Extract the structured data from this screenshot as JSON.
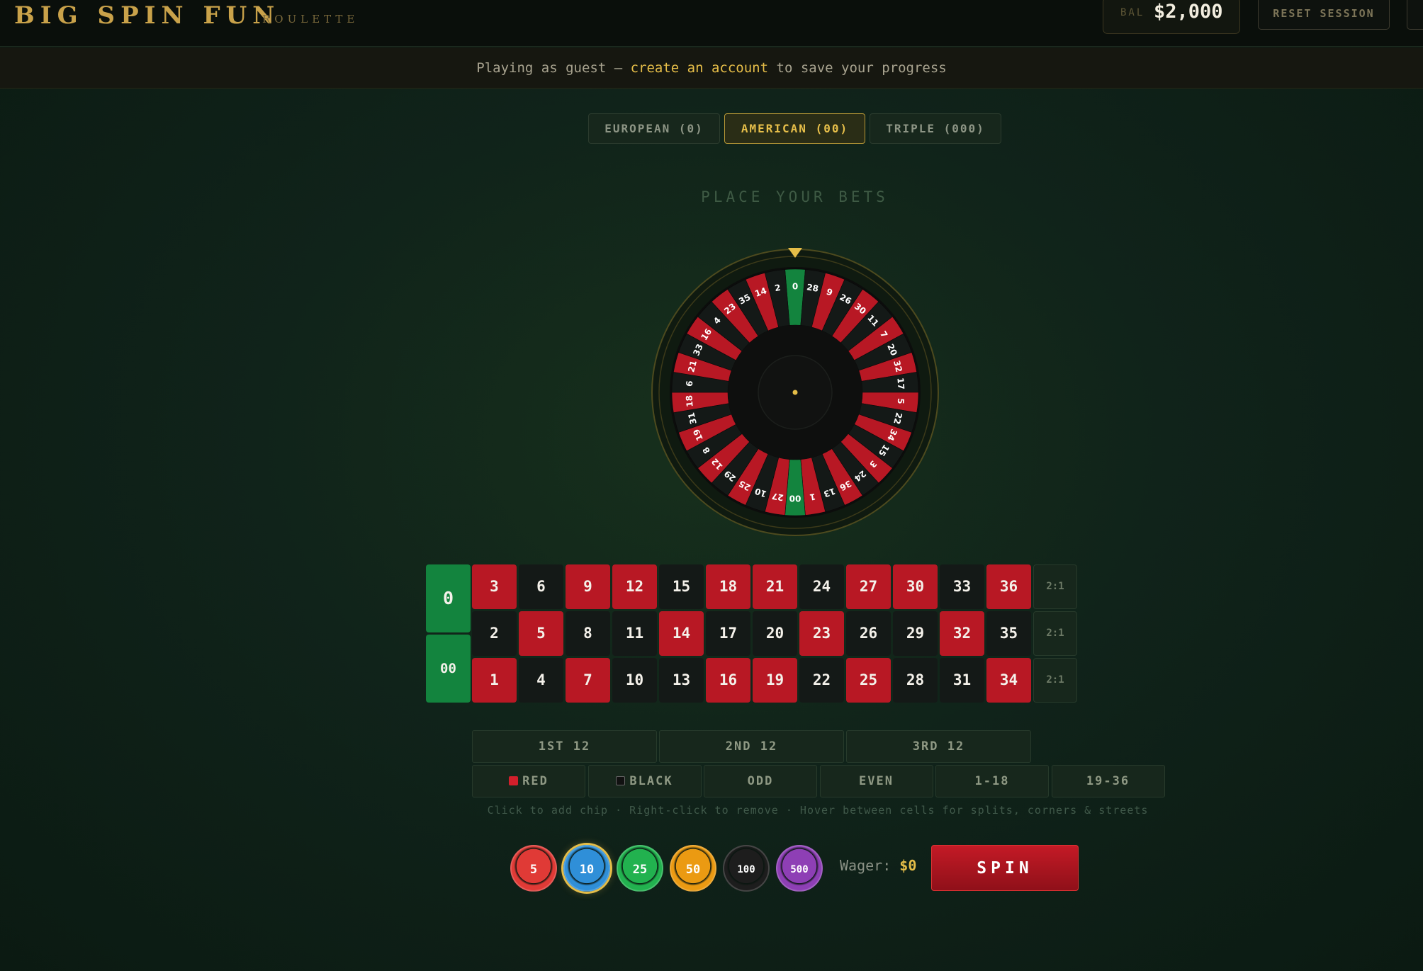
{
  "header": {
    "brand": "BIG SPIN FUN",
    "brand_sub": "ROULETTE",
    "balance_label": "BAL",
    "balance_value": "$2,000",
    "reset_label": "RESET SESSION"
  },
  "banner": {
    "prefix": "Playing as guest — ",
    "link": "create an account",
    "suffix": " to save your progress"
  },
  "modes": [
    {
      "label": "EUROPEAN (0)",
      "active": false
    },
    {
      "label": "AMERICAN (00)",
      "active": true
    },
    {
      "label": "TRIPLE (000)",
      "active": false
    }
  ],
  "status_text": "PLACE YOUR BETS",
  "wheel": {
    "sequence": [
      "0",
      "28",
      "9",
      "26",
      "30",
      "11",
      "7",
      "20",
      "32",
      "17",
      "5",
      "22",
      "34",
      "15",
      "3",
      "24",
      "36",
      "13",
      "1",
      "00",
      "27",
      "10",
      "25",
      "29",
      "12",
      "8",
      "19",
      "31",
      "18",
      "6",
      "21",
      "33",
      "16",
      "4",
      "23",
      "35",
      "14",
      "2"
    ]
  },
  "board": {
    "zero": "0",
    "double_zero": "00",
    "rows": [
      [
        "3",
        "6",
        "9",
        "12",
        "15",
        "18",
        "21",
        "24",
        "27",
        "30",
        "33",
        "36"
      ],
      [
        "2",
        "5",
        "8",
        "11",
        "14",
        "17",
        "20",
        "23",
        "26",
        "29",
        "32",
        "35"
      ],
      [
        "1",
        "4",
        "7",
        "10",
        "13",
        "16",
        "19",
        "22",
        "25",
        "28",
        "31",
        "34"
      ]
    ],
    "red_numbers": [
      "1",
      "3",
      "5",
      "7",
      "9",
      "12",
      "14",
      "16",
      "18",
      "19",
      "21",
      "23",
      "25",
      "27",
      "30",
      "32",
      "34",
      "36"
    ],
    "column_bets": [
      "2:1",
      "2:1",
      "2:1"
    ],
    "dozens": [
      "1ST 12",
      "2ND 12",
      "3RD 12"
    ],
    "even_money": [
      "RED",
      "BLACK",
      "ODD",
      "EVEN",
      "1-18",
      "19-36"
    ]
  },
  "hint": "Click to add chip · Right-click to remove · Hover between cells for splits, corners & streets",
  "chips": [
    {
      "value": "5",
      "color": "#e03a36",
      "selected": false
    },
    {
      "value": "10",
      "color": "#2f8fd8",
      "selected": true
    },
    {
      "value": "25",
      "color": "#22b24f",
      "selected": false
    },
    {
      "value": "50",
      "color": "#eb9a12",
      "selected": false
    },
    {
      "value": "100",
      "color": "#1d1d1d",
      "selected": false
    },
    {
      "value": "500",
      "color": "#8e3fb5",
      "selected": false
    }
  ],
  "wager_label": "Wager:",
  "wager_value": "$0",
  "spin_label": "SPIN",
  "colors": {
    "red": "#b81824",
    "black": "#141917",
    "green": "#13843e",
    "gold": "#e5bd48"
  }
}
